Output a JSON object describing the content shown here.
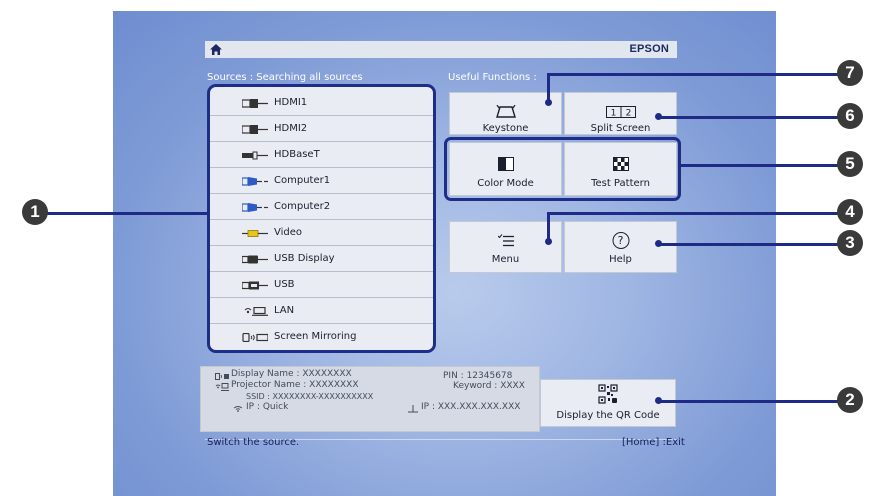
{
  "header": {
    "brand": "EPSON",
    "home_icon": "home-icon"
  },
  "sources": {
    "heading": "Sources :  Searching all sources",
    "items": [
      {
        "label": "HDMI1",
        "icon": "hdmi-icon"
      },
      {
        "label": "HDMI2",
        "icon": "hdmi-icon"
      },
      {
        "label": "HDBaseT",
        "icon": "hdbaset-icon"
      },
      {
        "label": "Computer1",
        "icon": "vga-icon"
      },
      {
        "label": "Computer2",
        "icon": "vga-icon"
      },
      {
        "label": "Video",
        "icon": "rca-icon"
      },
      {
        "label": "USB Display",
        "icon": "usb-display-icon"
      },
      {
        "label": "USB",
        "icon": "usb-icon"
      },
      {
        "label": "LAN",
        "icon": "lan-icon"
      },
      {
        "label": "Screen Mirroring",
        "icon": "screen-mirroring-icon"
      }
    ]
  },
  "functions": {
    "heading": "Useful Functions :",
    "keystone": "Keystone",
    "split_screen": "Split Screen",
    "split_glyph": "1|2",
    "color_mode": "Color Mode",
    "test_pattern": "Test Pattern",
    "menu": "Menu",
    "help": "Help",
    "help_glyph": "?"
  },
  "info": {
    "display_name": "Display Name :  XXXXXXXX",
    "projector_name": "Projector Name :  XXXXXXXX",
    "ssid": "SSID :  XXXXXXXX-XXXXXXXXXX",
    "ip_quick": "IP :  Quick",
    "pin": "PIN :  12345678",
    "keyword": "Keyword :  XXXX",
    "ip_lan": "IP :   XXX.XXX.XXX.XXX"
  },
  "qr": {
    "label": "Display the QR Code"
  },
  "footer": {
    "hint": "Switch the source.",
    "exit": "[Home] :Exit"
  },
  "callouts": [
    "1",
    "2",
    "3",
    "4",
    "5",
    "6",
    "7"
  ],
  "colors": {
    "screen_bg": "#8aa6dd",
    "highlight": "#1d2d88",
    "callout": "#3a3a3a"
  }
}
